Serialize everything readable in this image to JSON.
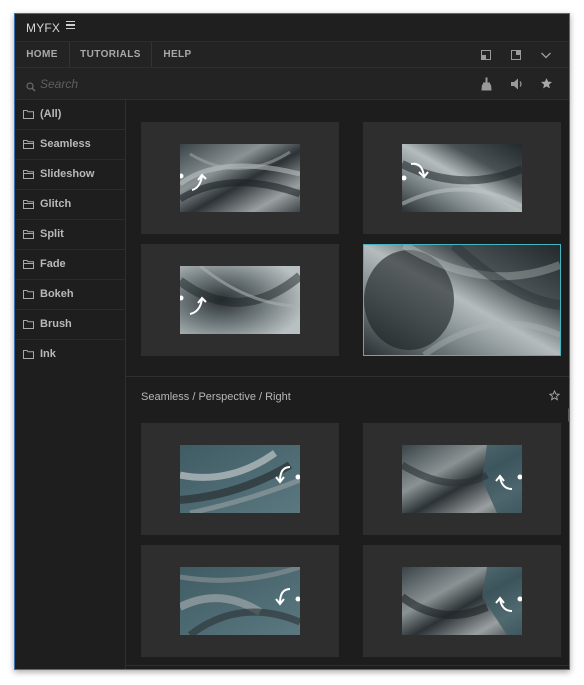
{
  "app": {
    "title": "MYFX"
  },
  "nav": {
    "items": [
      {
        "label": "HOME"
      },
      {
        "label": "TUTORIALS"
      },
      {
        "label": "HELP"
      }
    ]
  },
  "search": {
    "placeholder": "Search",
    "value": ""
  },
  "sidebar": {
    "items": [
      {
        "label": "(All)"
      },
      {
        "label": "Seamless"
      },
      {
        "label": "Slideshow"
      },
      {
        "label": "Glitch"
      },
      {
        "label": "Split"
      },
      {
        "label": "Fade"
      },
      {
        "label": "Bokeh"
      },
      {
        "label": "Brush"
      },
      {
        "label": "Ink"
      }
    ]
  },
  "section": {
    "title": "Seamless / Perspective / Right"
  },
  "colors": {
    "accent": "#43b6bf",
    "panel": "#232323",
    "card": "#2e2e2e",
    "border": "#3b6fb0"
  },
  "icons": [
    "hamburger-icon",
    "window-restore-icon",
    "window-popout-icon",
    "chevron-down-icon",
    "search-icon",
    "brush-icon",
    "speaker-icon",
    "star-icon",
    "folder-icon",
    "star-outline-icon"
  ]
}
